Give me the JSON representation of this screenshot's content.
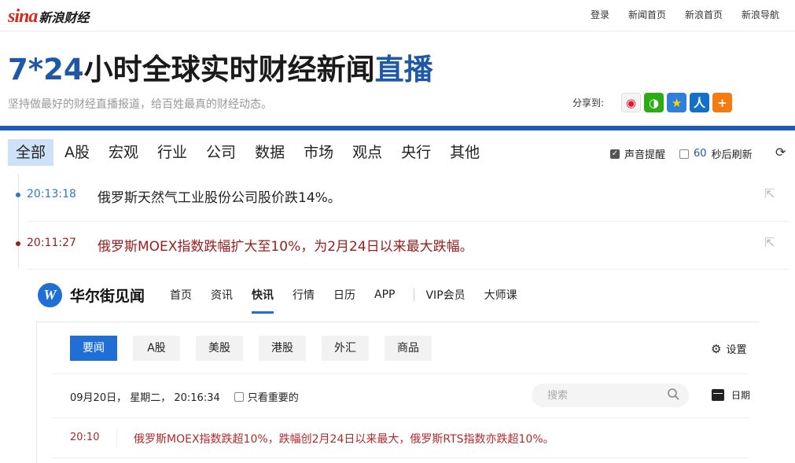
{
  "sina": {
    "logo_mark": "sina",
    "logo_text": "新浪财经",
    "top_links": [
      "登录",
      "新闻首页",
      "新浪首页",
      "新浪导航"
    ],
    "headline_blue_1": "7*24",
    "headline_black": "小时全球实时财经新闻",
    "headline_blue_2": "直播",
    "subline": "坚持做最好的财经直播报道，给百姓最真的财经动态。",
    "share_label": "分享到:",
    "share_icons": [
      "weibo-icon",
      "wechat-icon",
      "qzone-icon",
      "renren-icon",
      "more-share-icon"
    ],
    "categories": [
      "全部",
      "A股",
      "宏观",
      "行业",
      "公司",
      "数据",
      "市场",
      "观点",
      "央行",
      "其他"
    ],
    "active_category": "全部",
    "sound_label": "声音提醒",
    "sound_checked": true,
    "refresh_seconds": "60",
    "refresh_label": "秒后刷新",
    "refresh_checked": false,
    "feed": [
      {
        "time": "20:13:18",
        "text": "俄罗斯天然气工业股份公司股价跌14%。",
        "highlight": false
      },
      {
        "time": "20:11:27",
        "text": "俄罗斯MOEX指数跌幅扩大至10%，为2月24日以来最大跌幅。",
        "highlight": true
      }
    ],
    "colors": {
      "brand_red": "#d52b1e",
      "accent_blue": "#1e5bb4",
      "highlight_red": "#9b1c1c",
      "time_blue": "#2b7ac4"
    }
  },
  "wscn": {
    "logo_letter": "W",
    "name": "华尔街见闻",
    "nav": [
      "首页",
      "资讯",
      "快讯",
      "行情",
      "日历",
      "APP",
      "VIP会员",
      "大师课"
    ],
    "active_nav": "快讯",
    "tabs": [
      "要闻",
      "A股",
      "美股",
      "港股",
      "外汇",
      "商品"
    ],
    "active_tab": "要闻",
    "settings_label": "设置",
    "date_text": "09月20日， 星期二， 20:16:34",
    "important_only_label": "只看重要的",
    "search_placeholder": "搜索",
    "calendar_label": "日期",
    "news": [
      {
        "time": "20:10",
        "text": "俄罗斯MOEX指数跌超10%，跌幅创2月24日以来最大，俄罗斯RTS指数亦跌超10%。"
      }
    ],
    "colors": {
      "accent": "#1f6fd6",
      "news_red": "#b5282c"
    }
  }
}
